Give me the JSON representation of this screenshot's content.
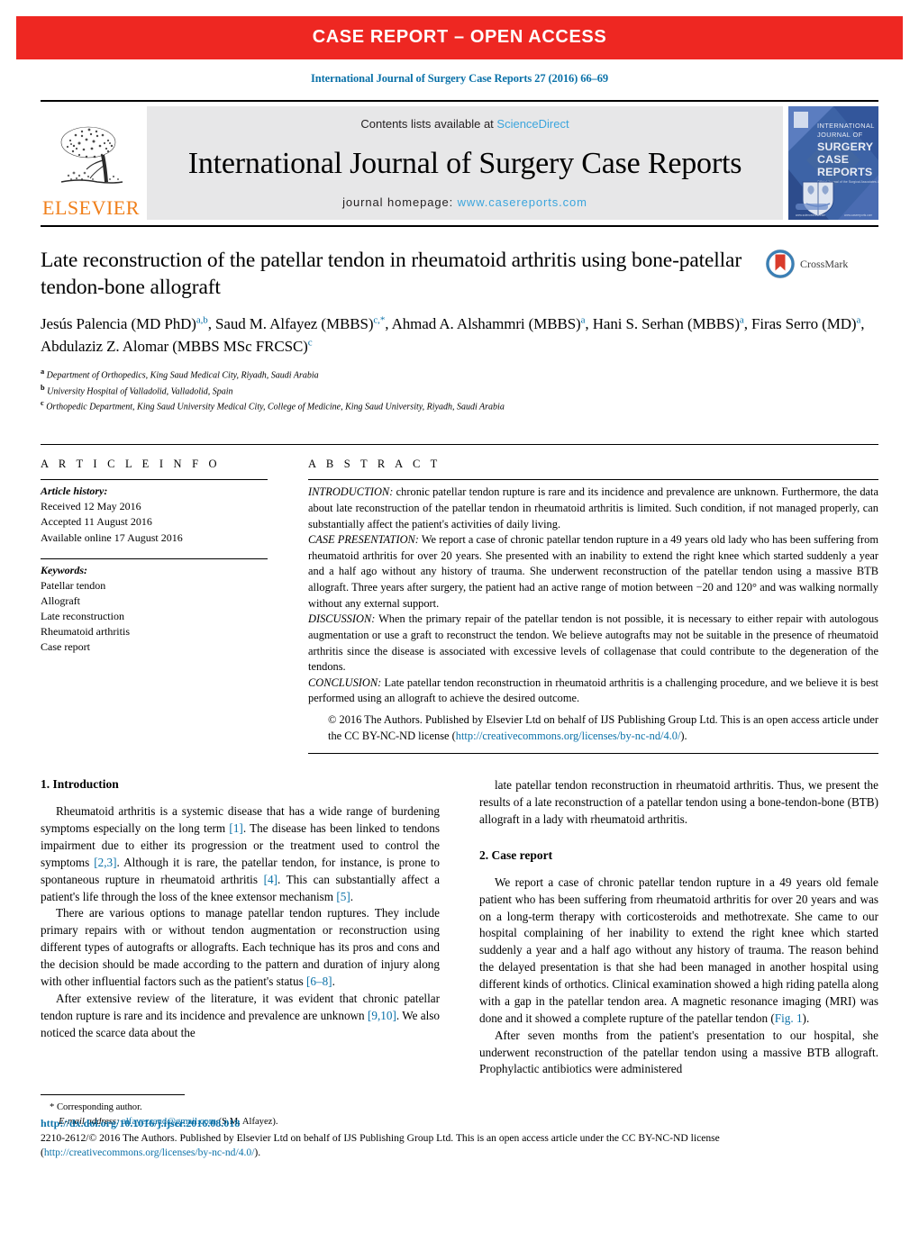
{
  "banner": {
    "text": "CASE REPORT – OPEN ACCESS"
  },
  "running_head": {
    "citation": "International Journal of Surgery Case Reports 27 (2016) 66–69"
  },
  "masthead": {
    "publisher": "ELSEVIER",
    "contents_prefix": "Contents lists available at ",
    "contents_link": "ScienceDirect",
    "journal_title": "International Journal of Surgery Case Reports",
    "homepage_prefix": "journal homepage: ",
    "homepage_url": "www.casereports.com",
    "cover": {
      "line1": "INTERNATIONAL",
      "line2": "JOURNAL OF",
      "line3": "SURGERY",
      "line4": "CASE",
      "line5": "REPORTS"
    }
  },
  "article": {
    "title": "Late reconstruction of the patellar tendon in rheumatoid arthritis using bone-patellar tendon-bone allograft",
    "crossmark_label": "CrossMark",
    "authors": [
      {
        "name": "Jesús Palencia (MD PhD)",
        "marks": "a,b",
        "sep": ", "
      },
      {
        "name": "Saud M. Alfayez (MBBS)",
        "marks": "c,*",
        "sep": ", "
      },
      {
        "name": "Ahmad A. Alshammri (MBBS)",
        "marks": "a",
        "sep": ", "
      },
      {
        "name": "Hani S. Serhan (MBBS)",
        "marks": "a",
        "sep": ", "
      },
      {
        "name": "Firas Serro (MD)",
        "marks": "a",
        "sep": ", "
      },
      {
        "name": "Abdulaziz Z. Alomar (MBBS MSc FRCSC)",
        "marks": "c",
        "sep": ""
      }
    ],
    "affiliations": [
      {
        "mark": "a",
        "text": "Department of Orthopedics, King Saud Medical City, Riyadh, Saudi Arabia"
      },
      {
        "mark": "b",
        "text": "University Hospital of Valladolid, Valladolid, Spain"
      },
      {
        "mark": "c",
        "text": "Orthopedic Department, King Saud University Medical City, College of Medicine, King Saud University, Riyadh, Saudi Arabia"
      }
    ]
  },
  "article_info": {
    "heading": "A R T I C L E    I N F O",
    "history_label": "Article history:",
    "history": [
      "Received 12 May 2016",
      "Accepted 11 August 2016",
      "Available online 17 August 2016"
    ],
    "keywords_label": "Keywords:",
    "keywords": [
      "Patellar tendon",
      "Allograft",
      "Late reconstruction",
      "Rheumatoid arthritis",
      "Case report"
    ]
  },
  "abstract": {
    "heading": "A B S T R A C T",
    "sections": [
      {
        "label": "INTRODUCTION:",
        "text": " chronic patellar tendon rupture is rare and its incidence and prevalence are unknown. Furthermore, the data about late reconstruction of the patellar tendon in rheumatoid arthritis is limited. Such condition, if not managed properly, can substantially affect the patient's activities of daily living."
      },
      {
        "label": "CASE PRESENTATION:",
        "text": " We report a case of chronic patellar tendon rupture in a 49 years old lady who has been suffering from rheumatoid arthritis for over 20 years. She presented with an inability to extend the right knee which started suddenly a year and a half ago without any history of trauma. She underwent reconstruction of the patellar tendon using a massive BTB allograft. Three years after surgery, the patient had an active range of motion between −20 and 120° and was walking normally without any external support."
      },
      {
        "label": "DISCUSSION:",
        "text": " When the primary repair of the patellar tendon is not possible, it is necessary to either repair with autologous augmentation or use a graft to reconstruct the tendon. We believe autografts may not be suitable in the presence of rheumatoid arthritis since the disease is associated with excessive levels of collagenase that could contribute to the degeneration of the tendons."
      },
      {
        "label": "CONCLUSION:",
        "text": " Late patellar tendon reconstruction in rheumatoid arthritis is a challenging procedure, and we believe it is best performed using an allograft to achieve the desired outcome."
      }
    ],
    "copyright_prefix": "© 2016 The Authors. Published by Elsevier Ltd on behalf of IJS Publishing Group Ltd. This is an open access article under the CC BY-NC-ND license (",
    "copyright_link": "http://creativecommons.org/licenses/by-nc-nd/4.0/",
    "copyright_suffix": ")."
  },
  "body": {
    "left": {
      "heading": "1.  Introduction",
      "paragraphs": [
        "Rheumatoid arthritis is a systemic disease that has a wide range of burdening symptoms especially on the long term [1]. The disease has been linked to tendons impairment due to either its progression or the treatment used to control the symptoms [2,3]. Although it is rare, the patellar tendon, for instance, is prone to spontaneous rupture in rheumatoid arthritis [4]. This can substantially affect a patient's life through the loss of the knee extensor mechanism [5].",
        "There are various options to manage patellar tendon ruptures. They include primary repairs with or without tendon augmentation or reconstruction using different types of autografts or allografts. Each technique has its pros and cons and the decision should be made according to the pattern and duration of injury along with other influential factors such as the patient's status [6–8].",
        "After extensive review of the literature, it was evident that chronic patellar tendon rupture is rare and its incidence and prevalence are unknown [9,10]. We also noticed the scarce data about the"
      ]
    },
    "right": {
      "lead_paragraph": "late patellar tendon reconstruction in rheumatoid arthritis. Thus, we present the results of a late reconstruction of a patellar tendon using a bone-tendon-bone (BTB) allograft in a lady with rheumatoid arthritis.",
      "heading": "2.  Case report",
      "paragraphs": [
        "We report a case of chronic patellar tendon rupture in a 49 years old female patient who has been suffering from rheumatoid arthritis for over 20 years and was on a long-term therapy with corticosteroids and methotrexate. She came to our hospital complaining of her inability to extend the right knee which started suddenly a year and a half ago without any history of trauma. The reason behind the delayed presentation is that she had been managed in another hospital using different kinds of orthotics. Clinical examination showed a high riding patella along with a gap in the patellar tendon area. A magnetic resonance imaging (MRI) was done and it showed a complete rupture of the patellar tendon (Fig. 1).",
        "After seven months from the patient's presentation to our hospital, she underwent reconstruction of the patellar tendon using a massive BTB allograft. Prophylactic antibiotics were administered"
      ],
      "figure_ref": "Fig. 1"
    }
  },
  "footnote": {
    "star": "*",
    "corresponding": "Corresponding author.",
    "email_label": "E-mail address:",
    "email": "alfayezsaud@gmail.com",
    "email_owner": "(S.M. Alfayez)."
  },
  "bottom": {
    "doi": "http://dx.doi.org/10.1016/j.ijscr.2016.08.018",
    "copyright_prefix": "2210-2612/© 2016 The Authors. Published by Elsevier Ltd on behalf of IJS Publishing Group Ltd. This is an open access article under the CC BY-NC-ND license (",
    "copyright_link_1": "http://",
    "copyright_link_2": "creativecommons.org/licenses/by-nc-nd/4.0/",
    "copyright_suffix": ")."
  },
  "colors": {
    "banner_red": "#ee2722",
    "link_blue": "#0a71a8",
    "light_blue": "#3ba5dd",
    "elsevier_orange": "#f07f1a",
    "masthead_gray": "#e7e7e8"
  }
}
